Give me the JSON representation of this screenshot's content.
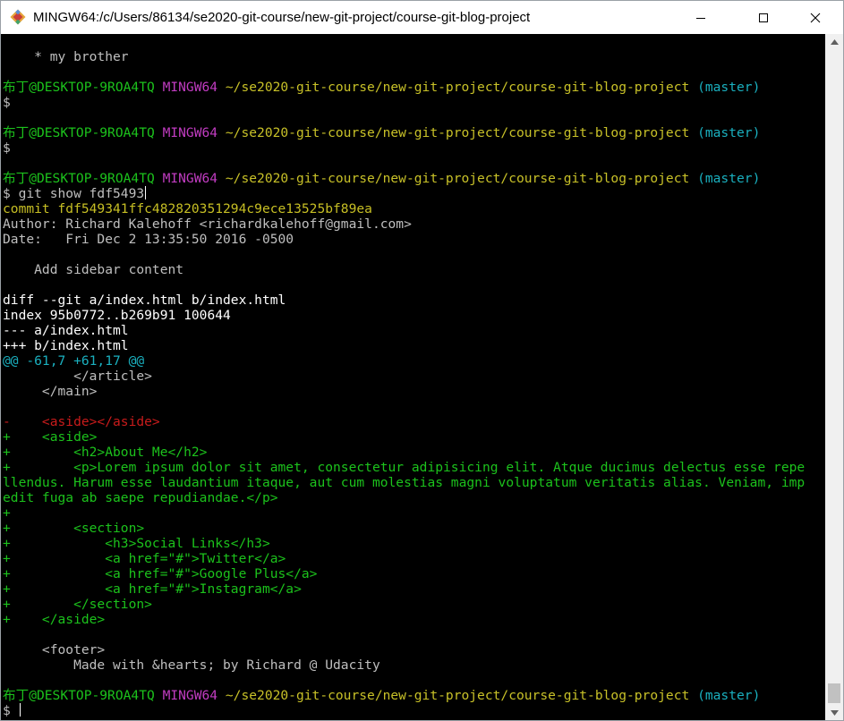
{
  "window": {
    "title": "MINGW64:/c/Users/86134/se2020-git-course/new-git-project/course-git-blog-project",
    "icon": "git-for-windows-icon"
  },
  "prompt": {
    "user_host": "布丁@DESKTOP-9ROA4TQ",
    "shell": "MINGW64",
    "path": "~/se2020-git-course/new-git-project/course-git-blog-project",
    "branch": "(master)",
    "symbol": "$"
  },
  "terminal": {
    "line_01": "    * my brother",
    "cmd_show": "$ git show fdf5493",
    "commit": "commit fdf549341ffc482820351294c9ece13525bf89ea",
    "author": "Author: Richard Kalehoff <richardkalehoff@gmail.com>",
    "date": "Date:   Fri Dec 2 13:35:50 2016 -0500",
    "message": "    Add sidebar content",
    "diff_header": "diff --git a/index.html b/index.html",
    "index_line": "index 95b0772..b269b91 100644",
    "minus_file": "--- a/index.html",
    "plus_file": "+++ b/index.html",
    "hunk": "@@ -61,7 +61,17 @@",
    "ctx_article": "         </article>",
    "ctx_main": "     </main>",
    "ctx_blank": "",
    "del_aside": "-    <aside></aside>",
    "add_01": "+    <aside>",
    "add_02": "+        <h2>About Me</h2>",
    "add_03": "+        <p>Lorem ipsum dolor sit amet, consectetur adipisicing elit. Atque ducimus delectus esse repe",
    "add_04": "llendus. Harum esse laudantium itaque, aut cum molestias magni voluptatum veritatis alias. Veniam, imp",
    "add_05": "edit fuga ab saepe repudiandae.</p>",
    "add_06": "+",
    "add_07": "+        <section>",
    "add_08": "+            <h3>Social Links</h3>",
    "add_09": "+            <a href=\"#\">Twitter</a>",
    "add_10": "+            <a href=\"#\">Google Plus</a>",
    "add_11": "+            <a href=\"#\">Instagram</a>",
    "add_12": "+        </section>",
    "add_13": "+    </aside>",
    "ctx_footer": "     <footer>",
    "ctx_made": "         Made with &hearts; by Richard @ Udacity"
  },
  "colors": {
    "terminal_bg": "#000000",
    "added": "#1cc21c",
    "removed": "#c91b1b",
    "hunk": "#1ab0bf",
    "user_host": "#1cc21c",
    "shell": "#c13cc1",
    "path": "#c8c128",
    "branch": "#1ab0bf",
    "commit": "#c8c128"
  }
}
